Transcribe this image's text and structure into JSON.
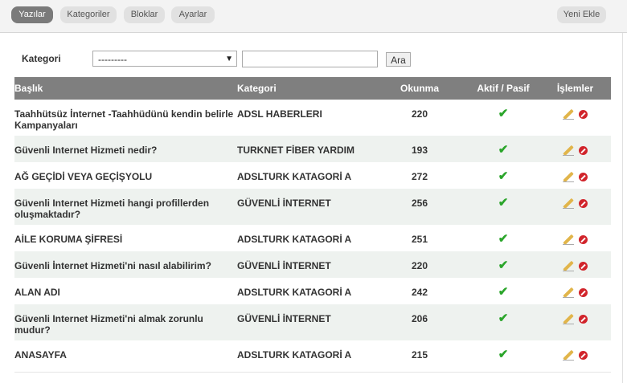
{
  "nav": {
    "tabs": [
      "Yazılar",
      "Kategoriler",
      "Bloklar",
      "Ayarlar"
    ],
    "add_new": "Yeni Ekle"
  },
  "filter": {
    "label": "Kategori",
    "select_value": "---------",
    "text_value": "",
    "search_button": "Ara"
  },
  "table": {
    "headers": [
      "Başlık",
      "Kategori",
      "Okunma",
      "Aktif / Pasif",
      "İşlemler"
    ],
    "rows": [
      {
        "title": "Taahhütsüz İnternet -Taahhüdünü kendin belirle Kampanyaları",
        "category": "ADSL HABERLERI",
        "reads": "220",
        "active": true
      },
      {
        "title": "Güvenli Internet Hizmeti nedir?",
        "category": "TURKNET FİBER YARDIM",
        "reads": "193",
        "active": true
      },
      {
        "title": "AĞ GEÇİDİ VEYA GEÇİŞYOLU",
        "category": "ADSLTURK KATAGORİ A",
        "reads": "272",
        "active": true
      },
      {
        "title": "Güvenli Internet Hizmeti hangi profillerden oluşmaktadır?",
        "category": "GÜVENLİ İNTERNET",
        "reads": "256",
        "active": true
      },
      {
        "title": "AİLE KORUMA ŞİFRESİ",
        "category": "ADSLTURK KATAGORİ A",
        "reads": "251",
        "active": true
      },
      {
        "title": "Güvenli İnternet Hizmeti'ni nasıl alabilirim?",
        "category": "GÜVENLİ İNTERNET",
        "reads": "220",
        "active": true
      },
      {
        "title": "ALAN ADI",
        "category": "ADSLTURK KATAGORİ A",
        "reads": "242",
        "active": true
      },
      {
        "title": "Güvenli Internet Hizmeti'ni almak zorunlu mudur?",
        "category": "GÜVENLİ İNTERNET",
        "reads": "206",
        "active": true
      },
      {
        "title": "ANASAYFA",
        "category": "ADSLTURK KATAGORİ A",
        "reads": "215",
        "active": true
      }
    ]
  },
  "icons": {
    "active": "check-icon",
    "edit": "pencil-icon",
    "delete": "delete-icon"
  },
  "colors": {
    "active_tab": "#7a7a7a",
    "header_bg": "#7f7f7f",
    "alt_row": "#eef2ef",
    "check": "#2aa52a",
    "delete": "#d1242b"
  }
}
